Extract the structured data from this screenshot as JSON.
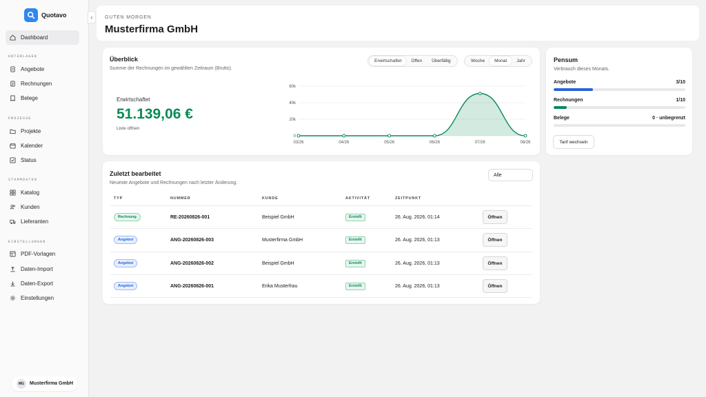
{
  "app": {
    "name": "Quotavo"
  },
  "sidebar": {
    "dashboard": "Dashboard",
    "sections": [
      {
        "title": "UNTERLAGEN",
        "items": [
          "Angebote",
          "Rechnungen",
          "Belege"
        ]
      },
      {
        "title": "PROZESSE",
        "items": [
          "Projekte",
          "Kalender",
          "Status"
        ]
      },
      {
        "title": "STAMMDATEN",
        "items": [
          "Katalog",
          "Kunden",
          "Lieferanten"
        ]
      },
      {
        "title": "EINSTELLUNGEN",
        "items": [
          "PDF-Vorlagen",
          "Daten-Import",
          "Daten-Export",
          "Einstellungen"
        ]
      }
    ],
    "user": {
      "initials": "MG",
      "name": "Musterfirma GmbH"
    }
  },
  "header": {
    "greeting": "GUTEN MORGEN",
    "company": "Musterfirma GmbH"
  },
  "overview": {
    "title": "Überblick",
    "subtitle": "Summe der Rechnungen im gewählten Zeitraum (Brutto).",
    "filters": [
      "Erwirtschaftet",
      "Offen",
      "Überfällig"
    ],
    "active_filter": "Erwirtschaftet",
    "periods": [
      "Woche",
      "Monat",
      "Jahr"
    ],
    "active_period": "Monat",
    "kpi_label": "Erwirtschaftet",
    "kpi_value": "51.139,06 €",
    "kpi_link": "Liste offnen"
  },
  "chart_data": {
    "type": "area",
    "x": [
      "03/26",
      "04/26",
      "05/26",
      "06/26",
      "07/26",
      "08/26"
    ],
    "values": [
      0,
      0,
      0,
      0,
      51139,
      0
    ],
    "yticks": [
      "0",
      "20k",
      "40k",
      "60k"
    ],
    "ylim": [
      0,
      60000
    ],
    "color": "#0a8a55",
    "grid": true
  },
  "pensum": {
    "title": "Pensum",
    "subtitle": "Verbrauch dieses Monats.",
    "items": [
      {
        "label": "Angebote",
        "value": "3/10",
        "fraction": 0.3,
        "color": "#2864d6"
      },
      {
        "label": "Rechnungen",
        "value": "1/10",
        "fraction": 0.1,
        "color": "#0a8a55"
      },
      {
        "label": "Belege",
        "value": "0 · unbegrenzt",
        "fraction": 0,
        "color": "#0a8a55"
      }
    ],
    "button": "Tarif wechseln"
  },
  "recent": {
    "title": "Zuletzt bearbeitet",
    "subtitle": "Neueste Angebote und Rechnungen nach letzter Änderung.",
    "filter": "Alle",
    "columns": [
      "TYP",
      "NUMMER",
      "KUNDE",
      "AKTIVITÄT",
      "ZEITPUNKT"
    ],
    "open_label": "Öffnen",
    "rows": [
      {
        "type": "Rechnung",
        "number": "RE-20260826-001",
        "customer": "Beispiel GmbH",
        "activity": "Erstellt",
        "time": "26. Aug. 2026, 01:14"
      },
      {
        "type": "Angebot",
        "number": "ANG-20260826-003",
        "customer": "Musterfirma GmbH",
        "activity": "Erstellt",
        "time": "26. Aug. 2026, 01:13"
      },
      {
        "type": "Angebot",
        "number": "ANG-20260826-002",
        "customer": "Beispiel GmbH",
        "activity": "Erstellt",
        "time": "26. Aug. 2026, 01:13"
      },
      {
        "type": "Angebot",
        "number": "ANG-20260826-001",
        "customer": "Erika Musterfrau",
        "activity": "Erstellt",
        "time": "26. Aug. 2026, 01:13"
      }
    ]
  }
}
